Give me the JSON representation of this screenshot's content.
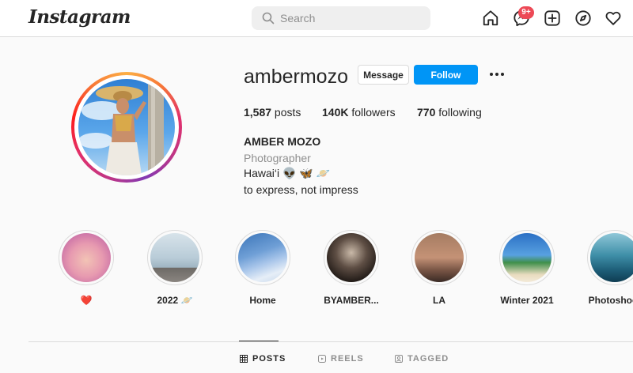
{
  "nav": {
    "logo": "Instagram",
    "search_placeholder": "Search",
    "notification_badge": "9+"
  },
  "profile": {
    "username": "ambermozo",
    "message_label": "Message",
    "follow_label": "Follow",
    "posts_count": "1,587",
    "posts_label": " posts",
    "followers_count": "140K",
    "followers_label": " followers",
    "following_count": "770",
    "following_label": " following",
    "full_name": "AMBER MOZO",
    "category": "Photographer",
    "bio_line1": "Hawai‘i 👽 🦋 🪐",
    "bio_line2": "to express, not impress"
  },
  "highlights": [
    {
      "label": "❤️"
    },
    {
      "label": "2022 🪐"
    },
    {
      "label": "Home"
    },
    {
      "label": "BYAMBER..."
    },
    {
      "label": "LA"
    },
    {
      "label": "Winter 2021"
    },
    {
      "label": "Photoshoot"
    }
  ],
  "tabs": [
    {
      "label": "POSTS",
      "active": true
    },
    {
      "label": "REELS",
      "active": false
    },
    {
      "label": "TAGGED",
      "active": false
    }
  ],
  "colors": {
    "follow_button": "#0095f6",
    "badge": "#ed4956",
    "text": "#262626",
    "muted": "#8e8e8e"
  }
}
